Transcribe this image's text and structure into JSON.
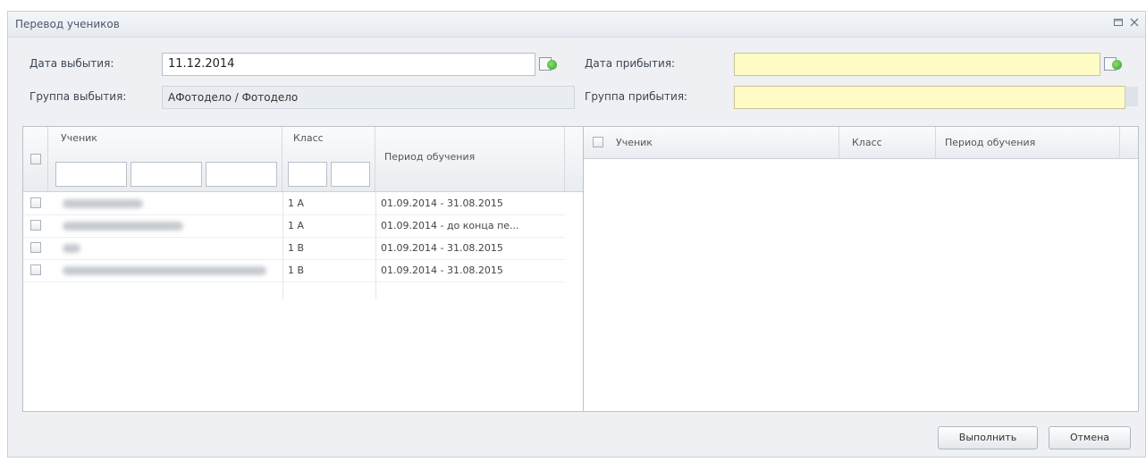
{
  "window": {
    "title": "Перевод учеников",
    "icons": [
      "restore-icon",
      "close-icon"
    ]
  },
  "departure": {
    "date_label": "Дата выбытия:",
    "date_value": "11.12.2014",
    "group_label": "Группа выбытия:",
    "group_value": "АФотодело / Фотодело"
  },
  "arrival": {
    "date_label": "Дата прибытия:",
    "date_value": "",
    "group_label": "Группа прибытия:",
    "group_value": ""
  },
  "left_grid": {
    "columns": [
      "Ученик",
      "Класс",
      "Период обучения"
    ],
    "rows": [
      {
        "student": "",
        "class": "1 А",
        "period": "01.09.2014 - 31.08.2015"
      },
      {
        "student": "",
        "class": "1 А",
        "period": "01.09.2014 - до конца пе..."
      },
      {
        "student": "",
        "class": "1 В",
        "period": "01.09.2014 - 31.08.2015"
      },
      {
        "student": "",
        "class": "1 В",
        "period": "01.09.2014 - 31.08.2015"
      }
    ]
  },
  "right_grid": {
    "columns": [
      "Ученик",
      "Класс",
      "Период обучения"
    ]
  },
  "buttons": {
    "execute": "Выполнить",
    "cancel": "Отмена"
  },
  "colors": {
    "required_field": "#fffcc6",
    "readonly_field": "#e9ecf0",
    "window_bg": "#eef0f3"
  }
}
